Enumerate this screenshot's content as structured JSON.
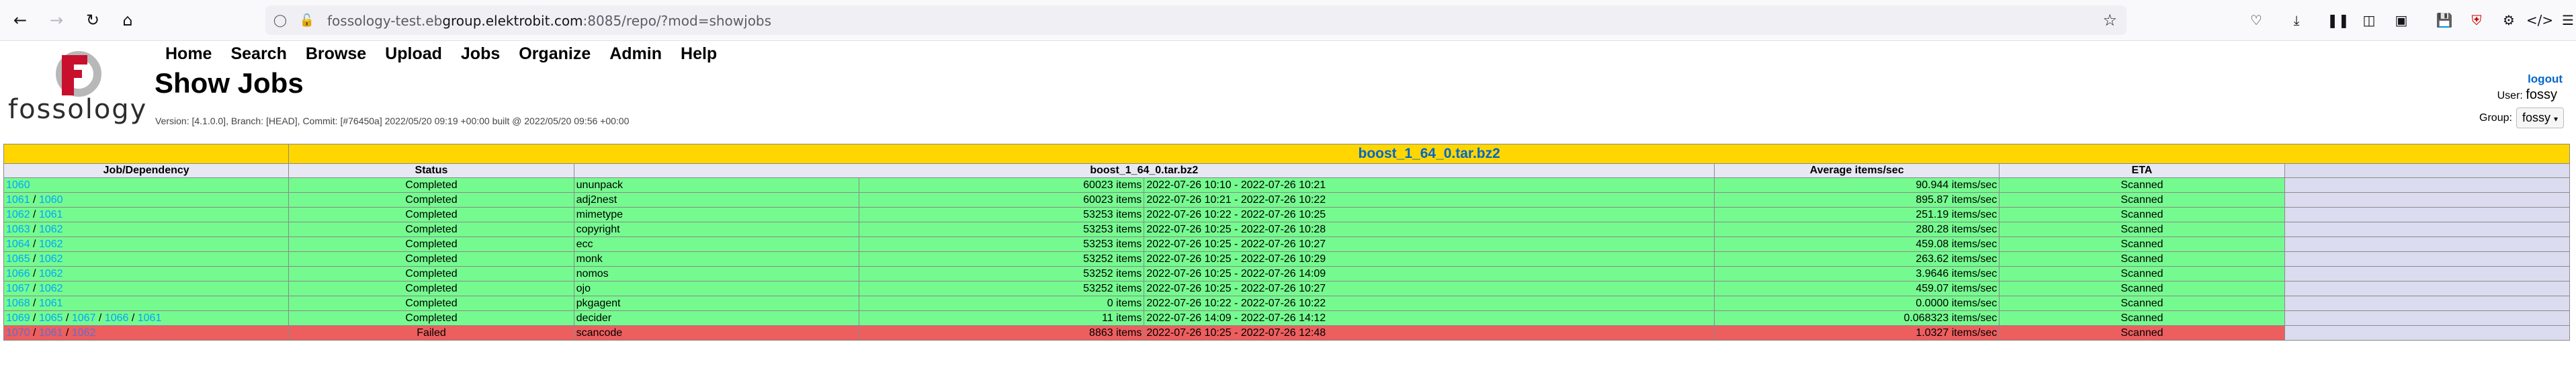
{
  "browser": {
    "url_prefix": "fossology-test.eb",
    "url_host": "group.elektrobit.com",
    "url_suffix": ":8085/repo/?mod=showjobs"
  },
  "header": {
    "logo_text": "fossology",
    "menu": [
      "Home",
      "Search",
      "Browse",
      "Upload",
      "Jobs",
      "Organize",
      "Admin",
      "Help"
    ],
    "title": "Show Jobs",
    "version": "Version: [4.1.0.0], Branch: [HEAD], Commit: [#76450a] 2022/05/20 09:19 +00:00 built @ 2022/05/20 09:56 +00:00",
    "logout": "logout",
    "user_label": "User:",
    "user_value": "fossy",
    "group_label": "Group:",
    "group_value": "fossy"
  },
  "table": {
    "upload_name": "boost_1_64_0.tar.bz2",
    "headers": [
      "Job/Dependency",
      "Status",
      "boost_1_64_0.tar.bz2",
      "Average items/sec",
      "ETA"
    ],
    "rows": [
      {
        "ids": [
          "1060"
        ],
        "status": "Completed",
        "agent": "ununpack",
        "items": "60023 items",
        "time": "2022-07-26 10:10 - 2022-07-26 10:21",
        "avg": "90.944 items/sec",
        "eta": "Scanned",
        "failed": false
      },
      {
        "ids": [
          "1061",
          "1060"
        ],
        "status": "Completed",
        "agent": "adj2nest",
        "items": "60023 items",
        "time": "2022-07-26 10:21 - 2022-07-26 10:22",
        "avg": "895.87 items/sec",
        "eta": "Scanned",
        "failed": false
      },
      {
        "ids": [
          "1062",
          "1061"
        ],
        "status": "Completed",
        "agent": "mimetype",
        "items": "53253 items",
        "time": "2022-07-26 10:22 - 2022-07-26 10:25",
        "avg": "251.19 items/sec",
        "eta": "Scanned",
        "failed": false
      },
      {
        "ids": [
          "1063",
          "1062"
        ],
        "status": "Completed",
        "agent": "copyright",
        "items": "53253 items",
        "time": "2022-07-26 10:25 - 2022-07-26 10:28",
        "avg": "280.28 items/sec",
        "eta": "Scanned",
        "failed": false
      },
      {
        "ids": [
          "1064",
          "1062"
        ],
        "status": "Completed",
        "agent": "ecc",
        "items": "53253 items",
        "time": "2022-07-26 10:25 - 2022-07-26 10:27",
        "avg": "459.08 items/sec",
        "eta": "Scanned",
        "failed": false
      },
      {
        "ids": [
          "1065",
          "1062"
        ],
        "status": "Completed",
        "agent": "monk",
        "items": "53252 items",
        "time": "2022-07-26 10:25 - 2022-07-26 10:29",
        "avg": "263.62 items/sec",
        "eta": "Scanned",
        "failed": false
      },
      {
        "ids": [
          "1066",
          "1062"
        ],
        "status": "Completed",
        "agent": "nomos",
        "items": "53252 items",
        "time": "2022-07-26 10:25 - 2022-07-26 14:09",
        "avg": "3.9646 items/sec",
        "eta": "Scanned",
        "failed": false
      },
      {
        "ids": [
          "1067",
          "1062"
        ],
        "status": "Completed",
        "agent": "ojo",
        "items": "53252 items",
        "time": "2022-07-26 10:25 - 2022-07-26 10:27",
        "avg": "459.07 items/sec",
        "eta": "Scanned",
        "failed": false
      },
      {
        "ids": [
          "1068",
          "1061"
        ],
        "status": "Completed",
        "agent": "pkgagent",
        "items": "0 items",
        "time": "2022-07-26 10:22 - 2022-07-26 10:22",
        "avg": "0.0000 items/sec",
        "eta": "Scanned",
        "failed": false
      },
      {
        "ids": [
          "1069",
          "1065",
          "1067",
          "1066",
          "1061"
        ],
        "status": "Completed",
        "agent": "decider",
        "items": "11 items",
        "time": "2022-07-26 14:09 - 2022-07-26 14:12",
        "avg": "0.068323 items/sec",
        "eta": "Scanned",
        "failed": false
      },
      {
        "ids": [
          "1070",
          "1061",
          "1062"
        ],
        "status": "Failed",
        "agent": "scancode",
        "items": "8863 items",
        "time": "2022-07-26 10:25 - 2022-07-26 12:48",
        "avg": "1.0327 items/sec",
        "eta": "Scanned",
        "failed": true
      }
    ]
  }
}
